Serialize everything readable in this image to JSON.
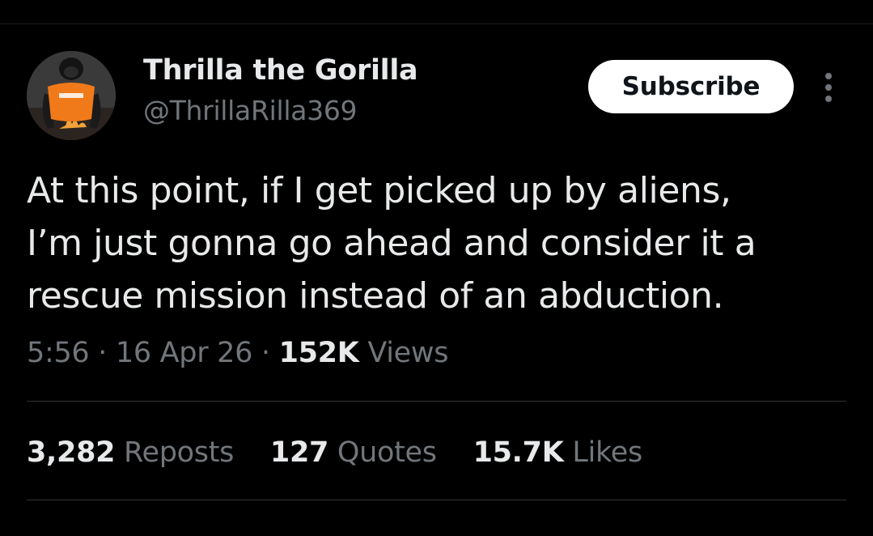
{
  "author": {
    "display_name": "Thrilla the Gorilla",
    "handle": "@ThrillaRilla369",
    "avatar_icon": "gorilla-avatar"
  },
  "actions": {
    "subscribe_label": "Subscribe",
    "more_icon": "more-vertical-icon"
  },
  "tweet": {
    "lines": [
      "At this point, if I get picked up by aliens,",
      "I’m just gonna go ahead and consider it a",
      "rescue mission instead of an abduction."
    ],
    "time": "5:56",
    "separator": "·",
    "date": "16 Apr 26",
    "views_count": "152K",
    "views_label": "Views"
  },
  "stats": {
    "reposts_count": "3,282",
    "reposts_label": "Reposts",
    "quotes_count": "127",
    "quotes_label": "Quotes",
    "likes_count": "15.7K",
    "likes_label": "Likes"
  },
  "colors": {
    "background": "#000000",
    "primary_text": "#e7e9ea",
    "secondary_text": "#71767b",
    "divider": "#2f3336",
    "button_bg": "#ffffff",
    "avatar_shirt": "#f07a1a"
  }
}
